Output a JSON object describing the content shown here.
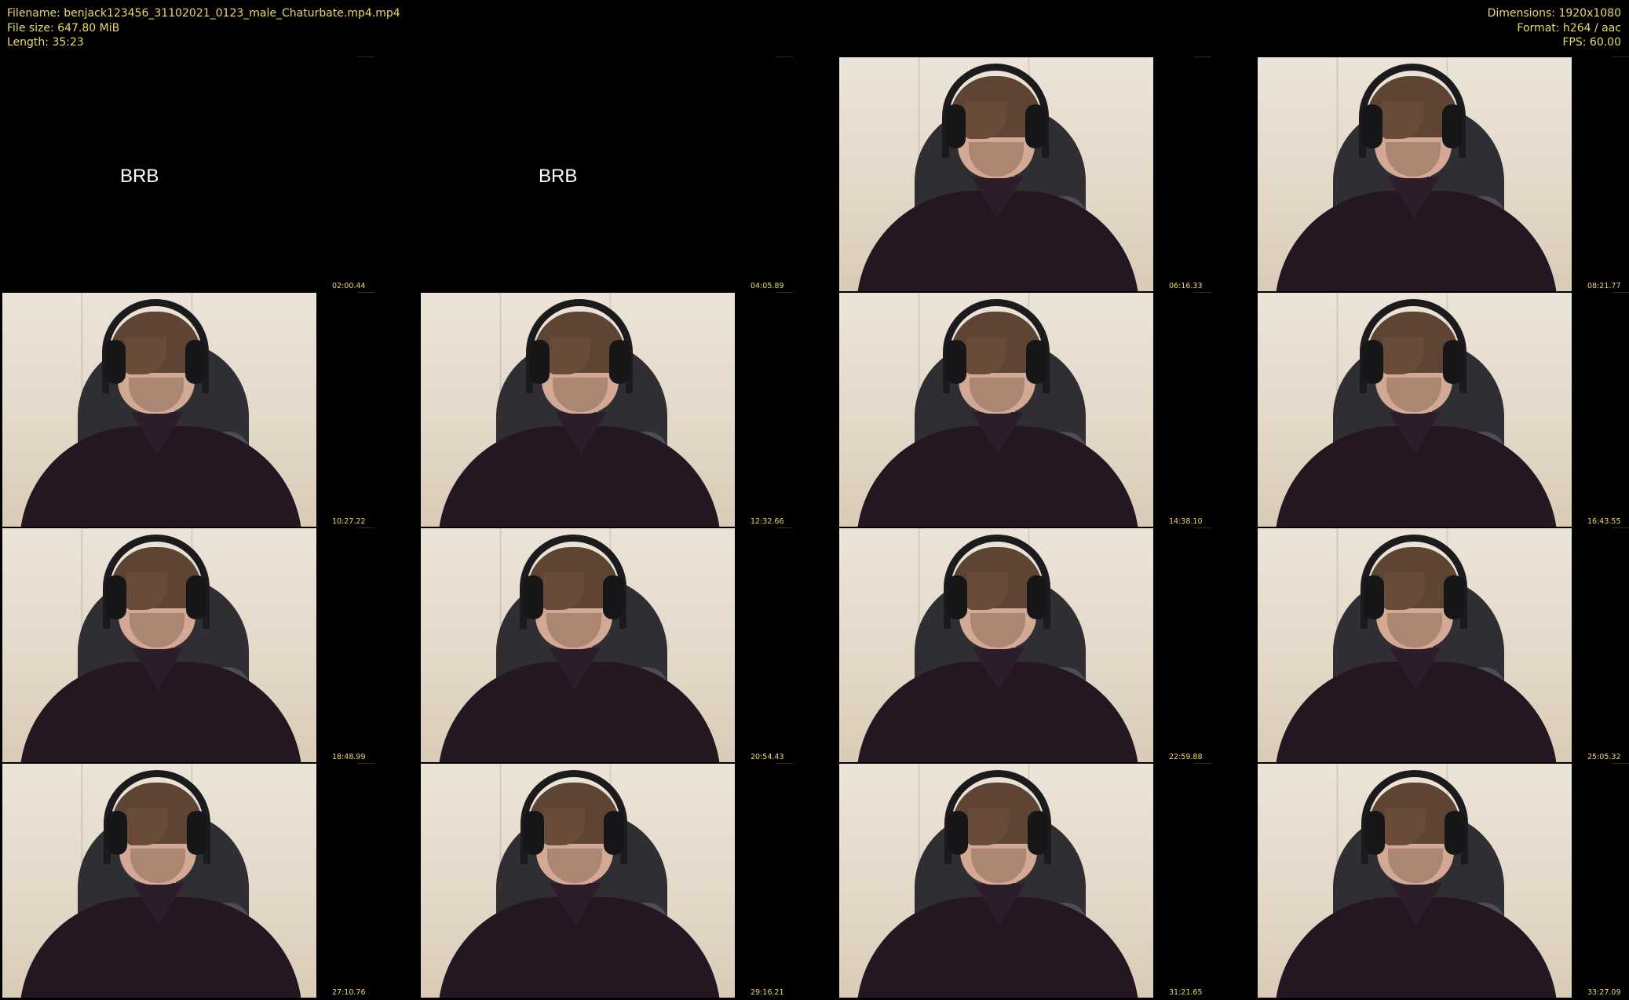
{
  "header": {
    "filename": "Filename: benjack123456_31102021_0123_male_Chaturbate.mp4.mp4",
    "filesize": "File size: 647.80 MiB",
    "length": "Length: 35:23",
    "dimensions": "Dimensions: 1920x1080",
    "format": "Format: h264 / aac",
    "fps": "FPS: 60.00"
  },
  "colors": {
    "text": "#e8d96a",
    "background": "#000000"
  },
  "thumbnails": [
    {
      "timestamp": "02:00.44",
      "kind": "brb",
      "overlay_text": "BRB"
    },
    {
      "timestamp": "04:05.89",
      "kind": "brb",
      "overlay_text": "BRB"
    },
    {
      "timestamp": "06:16.33",
      "kind": "webcam"
    },
    {
      "timestamp": "08:21.77",
      "kind": "webcam"
    },
    {
      "timestamp": "10:27.22",
      "kind": "webcam"
    },
    {
      "timestamp": "12:32.66",
      "kind": "webcam"
    },
    {
      "timestamp": "14:38.10",
      "kind": "webcam"
    },
    {
      "timestamp": "16:43.55",
      "kind": "webcam"
    },
    {
      "timestamp": "18:48.99",
      "kind": "webcam"
    },
    {
      "timestamp": "20:54.43",
      "kind": "webcam"
    },
    {
      "timestamp": "22:59.88",
      "kind": "webcam"
    },
    {
      "timestamp": "25:05.32",
      "kind": "webcam"
    },
    {
      "timestamp": "27:10.76",
      "kind": "webcam"
    },
    {
      "timestamp": "29:16.21",
      "kind": "webcam"
    },
    {
      "timestamp": "31:21.65",
      "kind": "webcam"
    },
    {
      "timestamp": "33:27.09",
      "kind": "webcam"
    }
  ]
}
